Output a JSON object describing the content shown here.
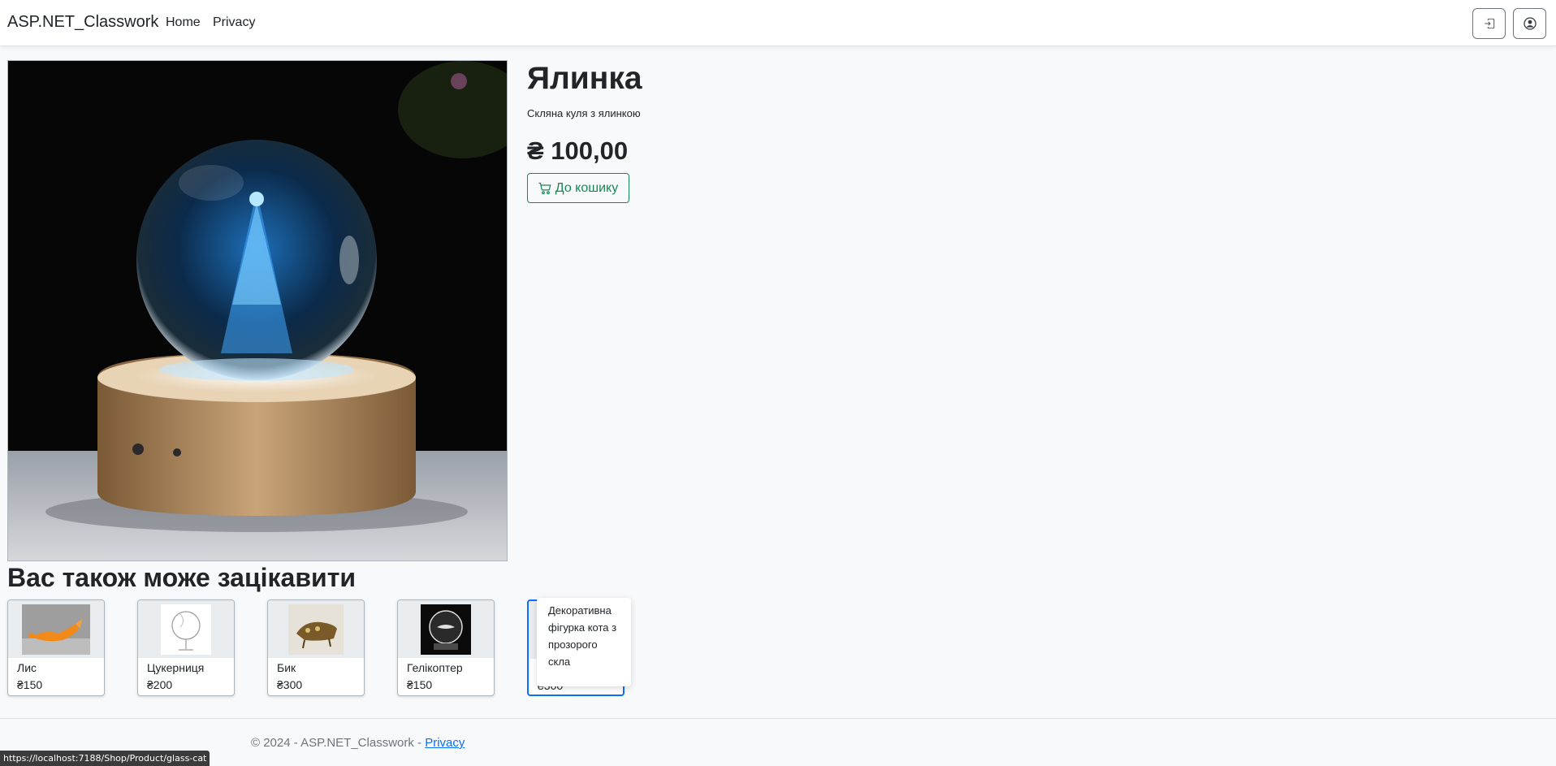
{
  "navbar": {
    "brand": "ASP.NET_Classwork",
    "links": [
      "Home",
      "Privacy"
    ]
  },
  "product": {
    "title": "Ялинка",
    "description": "Скляна куля з ялинкою",
    "price": "₴ 100,00",
    "cart_button": "До кошику"
  },
  "related": {
    "title": "Вас також може зацікавити",
    "items": [
      {
        "name": "Лис",
        "price": "₴150"
      },
      {
        "name": "Цукерниця",
        "price": "₴200"
      },
      {
        "name": "Бик",
        "price": "₴300"
      },
      {
        "name": "Гелікоптер",
        "price": "₴150"
      },
      {
        "name": "",
        "price": "₴300"
      }
    ],
    "tooltip": "Декоративна фігурка кота з прозорого скла"
  },
  "footer": {
    "copyright": "© 2024 - ASP.NET_Classwork - ",
    "privacy_link": "Privacy"
  },
  "status_bar": "https://localhost:7188/Shop/Product/glass-cat",
  "colors": {
    "success": "#198754",
    "primary": "#0d6efd",
    "background": "#f8f9fa"
  }
}
